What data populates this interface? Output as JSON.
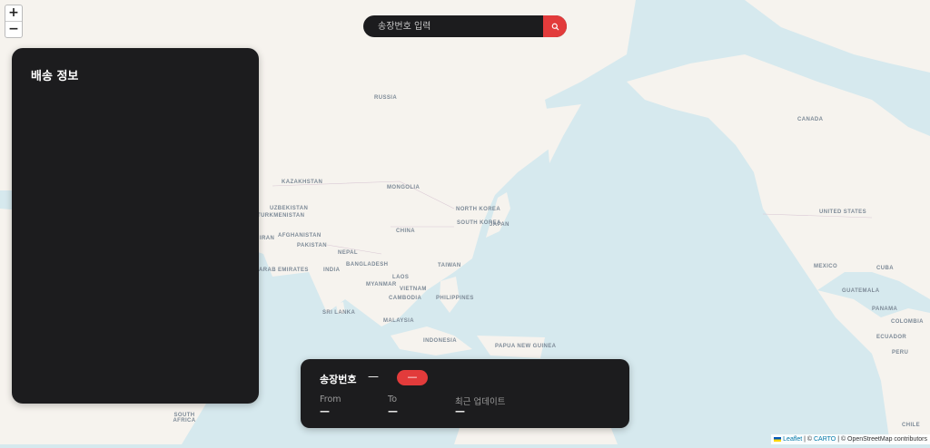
{
  "map": {
    "labels": {
      "russia": "RUSSIA",
      "canada": "CANADA",
      "kazakhstan": "KAZAKHSTAN",
      "mongolia": "MONGOLIA",
      "uzbekistan": "UZBEKISTAN",
      "turkmenistan": "TURKMENISTAN",
      "north_korea": "NORTH KOREA",
      "south_korea": "SOUTH KOREA",
      "japan": "JAPAN",
      "afghanistan": "AFGHANISTAN",
      "iran": "IRAN",
      "china": "CHINA",
      "united_states": "UNITED STATES",
      "pakistan": "PAKISTAN",
      "nepal": "NEPAL",
      "bangladesh": "BANGLADESH",
      "taiwan": "TAIWAN",
      "arab_emirates": "ARAB EMIRATES",
      "india": "INDIA",
      "myanmar": "MYANMAR",
      "laos": "LAOS",
      "vietnam": "VIETNAM",
      "cambodia": "CAMBODIA",
      "philippines": "PHILIPPINES",
      "mexico": "MEXICO",
      "cuba": "CUBA",
      "guatemala": "GUATEMALA",
      "sri_lanka": "SRI LANKA",
      "malaysia": "MALAYSIA",
      "panama": "PANAMA",
      "colombia": "COLOMBIA",
      "ecuador": "ECUADOR",
      "indonesia": "INDONESIA",
      "png": "PAPUA NEW GUINEA",
      "peru": "PERU",
      "south_africa": "SOUTH AFRICA",
      "chile": "CHILE"
    },
    "zoom_in": "+",
    "zoom_out": "−"
  },
  "search": {
    "placeholder": "송장번호 입력",
    "icon": "search-icon"
  },
  "info_panel": {
    "title": "배송 정보"
  },
  "summary": {
    "title": "송장번호",
    "number": "—",
    "status": "—",
    "from_label": "From",
    "from_value": "—",
    "to_label": "To",
    "to_value": "—",
    "updated_label": "최근 업데이트",
    "updated_value": "—"
  },
  "attribution": {
    "leaflet": "Leaflet",
    "sep1": " | © ",
    "carto": "CARTO",
    "sep2": " | © OpenStreetMap contributors"
  },
  "colors": {
    "land": "#f6f3ee",
    "water": "#d6e9ee",
    "panel": "#1c1c1e",
    "accent": "#e23b3b"
  }
}
